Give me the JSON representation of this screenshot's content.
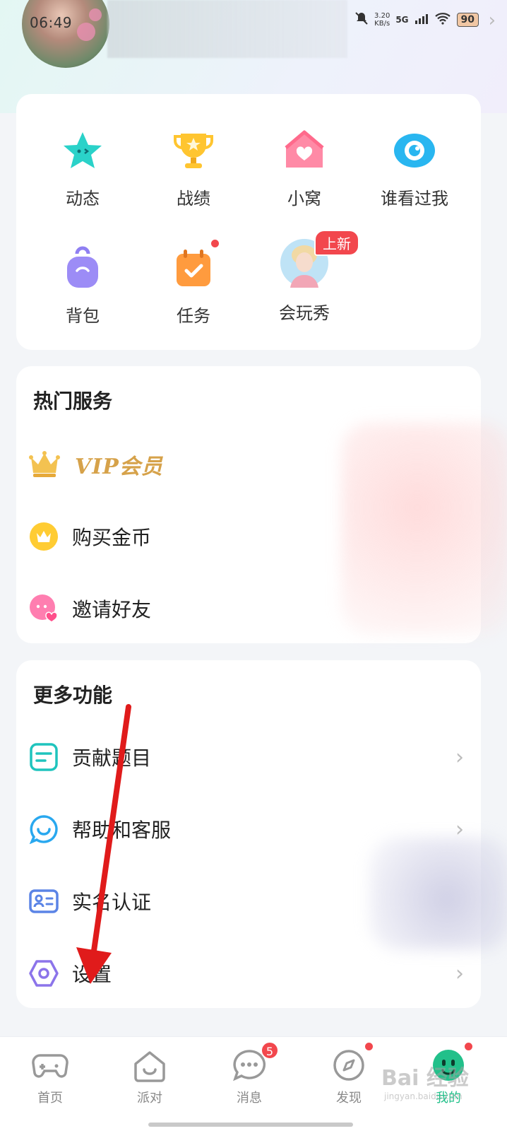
{
  "status_bar": {
    "time": "06:49",
    "net_speed": "3.20",
    "net_unit": "KB/s",
    "network": "5G",
    "battery": "90"
  },
  "features": [
    {
      "label": "动态",
      "icon": "star-face-icon"
    },
    {
      "label": "战绩",
      "icon": "trophy-icon"
    },
    {
      "label": "小窝",
      "icon": "house-heart-icon"
    },
    {
      "label": "谁看过我",
      "icon": "eye-icon"
    },
    {
      "label": "背包",
      "icon": "backpack-icon"
    },
    {
      "label": "任务",
      "icon": "calendar-check-icon"
    },
    {
      "label": "会玩秀",
      "icon": "avatar-show-icon",
      "badge": "上新"
    }
  ],
  "hot_services": {
    "title": "热门服务",
    "vip_label": "VIP会员",
    "items": [
      {
        "label": "购买金币",
        "icon": "coin-crown-icon"
      },
      {
        "label": "邀请好友",
        "icon": "invite-face-icon"
      }
    ]
  },
  "more_features": {
    "title": "更多功能",
    "items": [
      {
        "label": "贡献题目",
        "icon": "document-icon"
      },
      {
        "label": "帮助和客服",
        "icon": "customer-service-icon"
      },
      {
        "label": "实名认证",
        "icon": "id-card-icon"
      },
      {
        "label": "设置",
        "icon": "settings-hexagon-icon"
      }
    ]
  },
  "bottom_nav": [
    {
      "label": "首页",
      "icon": "gamepad-icon"
    },
    {
      "label": "派对",
      "icon": "party-house-icon"
    },
    {
      "label": "消息",
      "icon": "message-icon",
      "badge": "5"
    },
    {
      "label": "发现",
      "icon": "compass-icon"
    },
    {
      "label": "我的",
      "icon": "profile-face-icon",
      "active": true
    }
  ],
  "watermark": {
    "main": "Bai 经验",
    "sub": "jingyan.baidu.com"
  },
  "colors": {
    "accent": "#22c08a",
    "badge_red": "#f2474d",
    "vip_gold": "#d6a24a",
    "arrow_red": "#e01b1b"
  }
}
